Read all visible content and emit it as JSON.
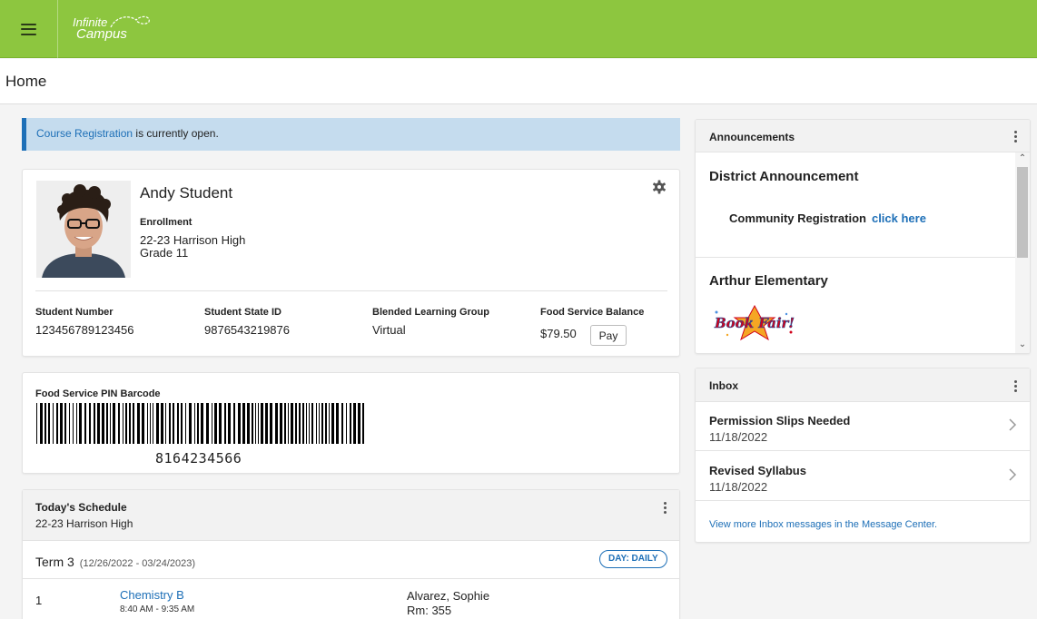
{
  "brand": {
    "line1": "Infinite",
    "line2": "Campus",
    "color": "#8dc63f"
  },
  "page": {
    "title": "Home"
  },
  "banner": {
    "link_text": "Course Registration",
    "rest_text": " is currently open."
  },
  "student": {
    "name": "Andy Student",
    "enrollment_label": "Enrollment",
    "school": "22-23 Harrison High",
    "grade": "Grade 11",
    "fields": [
      {
        "label": "Student Number",
        "value": "123456789123456"
      },
      {
        "label": "Student State ID",
        "value": "9876543219876"
      },
      {
        "label": "Blended Learning Group",
        "value": "Virtual"
      },
      {
        "label": "Food Service Balance",
        "value": "$79.50"
      }
    ],
    "pay_label": "Pay"
  },
  "barcode": {
    "label": "Food Service PIN Barcode",
    "number": "8164234566"
  },
  "schedule": {
    "title": "Today's Schedule",
    "school": "22-23 Harrison High",
    "term": "Term 3",
    "term_dates": "(12/26/2022 - 03/24/2023)",
    "day_label": "DAY: DAILY",
    "classes": [
      {
        "period": "1",
        "name": "Chemistry B",
        "time": "8:40 AM - 9:35 AM",
        "teacher": "Alvarez, Sophie",
        "room": "Rm: 355"
      }
    ]
  },
  "announcements": {
    "title": "Announcements",
    "items": [
      {
        "title": "District Announcement",
        "text": "Community Registration",
        "link": "click here"
      },
      {
        "title": "Arthur Elementary",
        "image_text": "Book Fair!"
      }
    ]
  },
  "inbox": {
    "title": "Inbox",
    "messages": [
      {
        "subject": "Permission Slips Needed",
        "date": "11/18/2022"
      },
      {
        "subject": "Revised Syllabus",
        "date": "11/18/2022"
      }
    ],
    "more_link": "View more Inbox messages in the Message Center."
  },
  "icons": {
    "menu": "hamburger-icon",
    "settings": "gear-icon",
    "more": "kebab-icon",
    "next": "chevron-right-icon"
  },
  "colors": {
    "link": "#1d6fb7",
    "banner_bg": "#c5dcee"
  }
}
